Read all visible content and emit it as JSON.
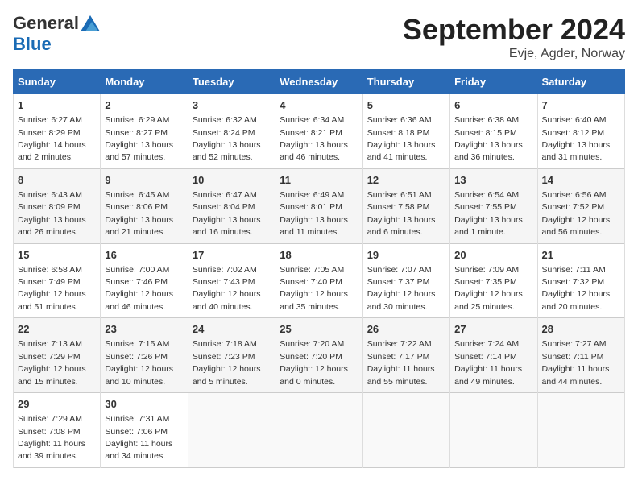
{
  "header": {
    "logo_general": "General",
    "logo_blue": "Blue",
    "month_title": "September 2024",
    "location": "Evje, Agder, Norway"
  },
  "days_of_week": [
    "Sunday",
    "Monday",
    "Tuesday",
    "Wednesday",
    "Thursday",
    "Friday",
    "Saturday"
  ],
  "weeks": [
    [
      {
        "day": "1",
        "sunrise": "6:27 AM",
        "sunset": "8:29 PM",
        "daylight": "14 hours and 2 minutes."
      },
      {
        "day": "2",
        "sunrise": "6:29 AM",
        "sunset": "8:27 PM",
        "daylight": "13 hours and 57 minutes."
      },
      {
        "day": "3",
        "sunrise": "6:32 AM",
        "sunset": "8:24 PM",
        "daylight": "13 hours and 52 minutes."
      },
      {
        "day": "4",
        "sunrise": "6:34 AM",
        "sunset": "8:21 PM",
        "daylight": "13 hours and 46 minutes."
      },
      {
        "day": "5",
        "sunrise": "6:36 AM",
        "sunset": "8:18 PM",
        "daylight": "13 hours and 41 minutes."
      },
      {
        "day": "6",
        "sunrise": "6:38 AM",
        "sunset": "8:15 PM",
        "daylight": "13 hours and 36 minutes."
      },
      {
        "day": "7",
        "sunrise": "6:40 AM",
        "sunset": "8:12 PM",
        "daylight": "13 hours and 31 minutes."
      }
    ],
    [
      {
        "day": "8",
        "sunrise": "6:43 AM",
        "sunset": "8:09 PM",
        "daylight": "13 hours and 26 minutes."
      },
      {
        "day": "9",
        "sunrise": "6:45 AM",
        "sunset": "8:06 PM",
        "daylight": "13 hours and 21 minutes."
      },
      {
        "day": "10",
        "sunrise": "6:47 AM",
        "sunset": "8:04 PM",
        "daylight": "13 hours and 16 minutes."
      },
      {
        "day": "11",
        "sunrise": "6:49 AM",
        "sunset": "8:01 PM",
        "daylight": "13 hours and 11 minutes."
      },
      {
        "day": "12",
        "sunrise": "6:51 AM",
        "sunset": "7:58 PM",
        "daylight": "13 hours and 6 minutes."
      },
      {
        "day": "13",
        "sunrise": "6:54 AM",
        "sunset": "7:55 PM",
        "daylight": "13 hours and 1 minute."
      },
      {
        "day": "14",
        "sunrise": "6:56 AM",
        "sunset": "7:52 PM",
        "daylight": "12 hours and 56 minutes."
      }
    ],
    [
      {
        "day": "15",
        "sunrise": "6:58 AM",
        "sunset": "7:49 PM",
        "daylight": "12 hours and 51 minutes."
      },
      {
        "day": "16",
        "sunrise": "7:00 AM",
        "sunset": "7:46 PM",
        "daylight": "12 hours and 46 minutes."
      },
      {
        "day": "17",
        "sunrise": "7:02 AM",
        "sunset": "7:43 PM",
        "daylight": "12 hours and 40 minutes."
      },
      {
        "day": "18",
        "sunrise": "7:05 AM",
        "sunset": "7:40 PM",
        "daylight": "12 hours and 35 minutes."
      },
      {
        "day": "19",
        "sunrise": "7:07 AM",
        "sunset": "7:37 PM",
        "daylight": "12 hours and 30 minutes."
      },
      {
        "day": "20",
        "sunrise": "7:09 AM",
        "sunset": "7:35 PM",
        "daylight": "12 hours and 25 minutes."
      },
      {
        "day": "21",
        "sunrise": "7:11 AM",
        "sunset": "7:32 PM",
        "daylight": "12 hours and 20 minutes."
      }
    ],
    [
      {
        "day": "22",
        "sunrise": "7:13 AM",
        "sunset": "7:29 PM",
        "daylight": "12 hours and 15 minutes."
      },
      {
        "day": "23",
        "sunrise": "7:15 AM",
        "sunset": "7:26 PM",
        "daylight": "12 hours and 10 minutes."
      },
      {
        "day": "24",
        "sunrise": "7:18 AM",
        "sunset": "7:23 PM",
        "daylight": "12 hours and 5 minutes."
      },
      {
        "day": "25",
        "sunrise": "7:20 AM",
        "sunset": "7:20 PM",
        "daylight": "12 hours and 0 minutes."
      },
      {
        "day": "26",
        "sunrise": "7:22 AM",
        "sunset": "7:17 PM",
        "daylight": "11 hours and 55 minutes."
      },
      {
        "day": "27",
        "sunrise": "7:24 AM",
        "sunset": "7:14 PM",
        "daylight": "11 hours and 49 minutes."
      },
      {
        "day": "28",
        "sunrise": "7:27 AM",
        "sunset": "7:11 PM",
        "daylight": "11 hours and 44 minutes."
      }
    ],
    [
      {
        "day": "29",
        "sunrise": "7:29 AM",
        "sunset": "7:08 PM",
        "daylight": "11 hours and 39 minutes."
      },
      {
        "day": "30",
        "sunrise": "7:31 AM",
        "sunset": "7:06 PM",
        "daylight": "11 hours and 34 minutes."
      },
      null,
      null,
      null,
      null,
      null
    ]
  ]
}
